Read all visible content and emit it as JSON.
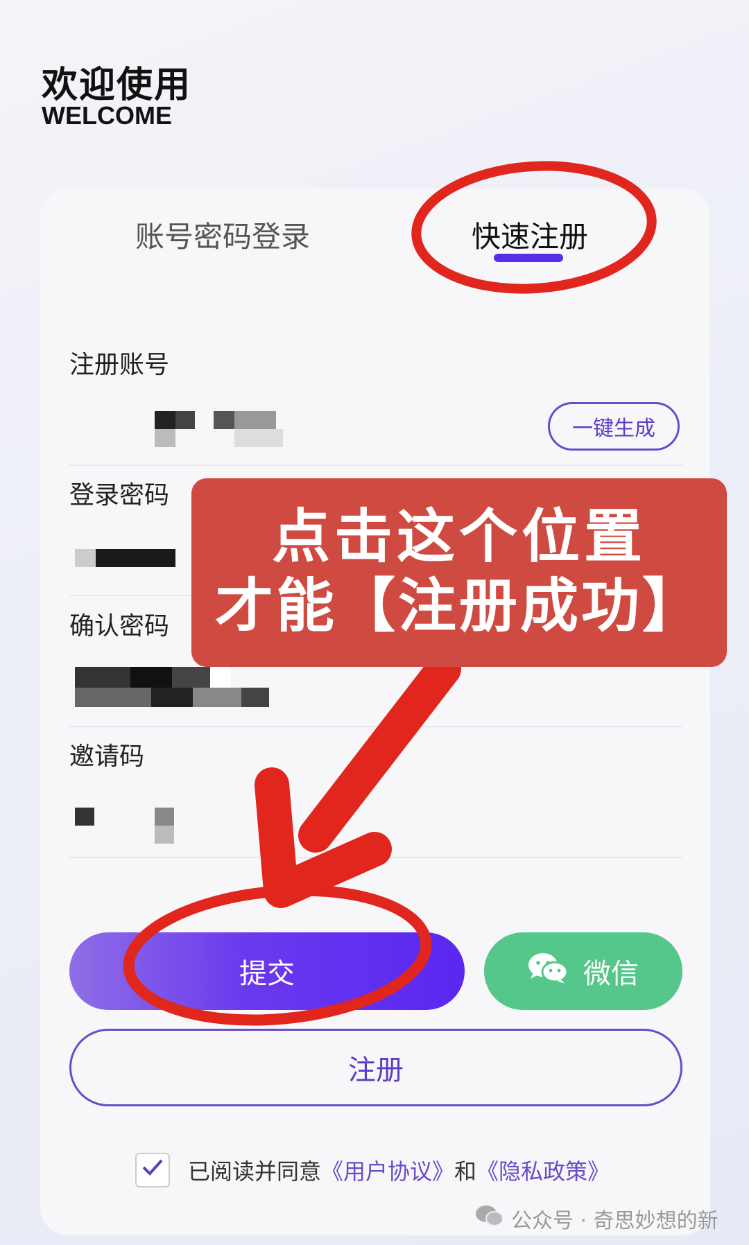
{
  "header": {
    "title_cn": "欢迎使用",
    "title_en": "WELCOME"
  },
  "tabs": [
    {
      "label": "账号密码登录",
      "active": false
    },
    {
      "label": "快速注册",
      "active": true
    }
  ],
  "form": {
    "account_label": "注册账号",
    "generate_label": "一键生成",
    "password_label": "登录密码",
    "confirm_label": "确认密码",
    "invite_label": "邀请码"
  },
  "buttons": {
    "submit": "提交",
    "wechat": "微信",
    "register": "注册"
  },
  "agreement": {
    "checked": true,
    "prefix": "已阅读并同意",
    "user_agreement": "《用户协议》",
    "and": "和",
    "privacy_policy": "《隐私政策》"
  },
  "annotation": {
    "line1": "点击这个位置",
    "line2": "才能【注册成功】"
  },
  "watermark": "公众号 · 奇思妙想的新",
  "colors": {
    "accent": "#5b2ce8",
    "wechat": "#55c78b",
    "annotation_red": "#e0261d",
    "callout_bg": "#cf4a40"
  }
}
